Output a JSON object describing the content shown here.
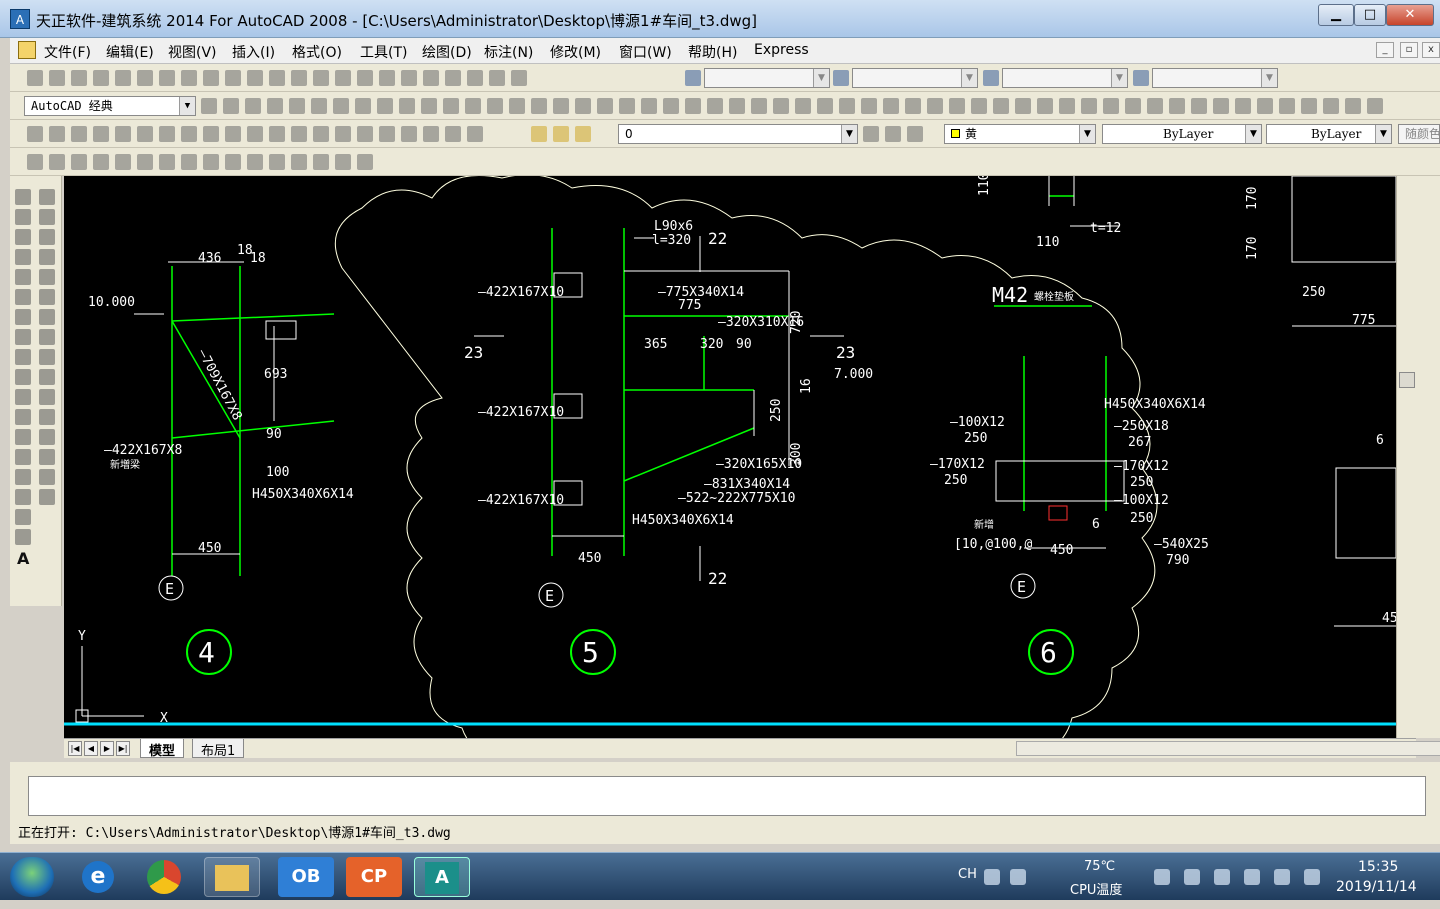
{
  "window": {
    "title": "天正软件-建筑系统 2014  For AutoCAD 2008 - [C:\\Users\\Administrator\\Desktop\\博源1#车间_t3.dwg]",
    "minimize": "▁",
    "maximize": "□",
    "close": "✕"
  },
  "menu": {
    "items": [
      "文件(F)",
      "编辑(E)",
      "视图(V)",
      "插入(I)",
      "格式(O)",
      "工具(T)",
      "绘图(D)",
      "标注(N)",
      "修改(M)",
      "窗口(W)",
      "帮助(H)",
      "Express"
    ]
  },
  "toolbar": {
    "workspace": "AutoCAD 经典",
    "layer": "0",
    "color": "黄",
    "linetype": "ByLayer",
    "lineweight": "ByLayer",
    "plotstyle": "随颜色"
  },
  "drawing": {
    "details": [
      {
        "label": "4",
        "axis": "E"
      },
      {
        "label": "5",
        "axis": "E"
      },
      {
        "label": "6",
        "axis": "E"
      }
    ],
    "texts": {
      "d436": "436",
      "d18a": "18",
      "d18b": "18",
      "elev10": "10.000",
      "d693": "693",
      "member_a": "—709X167X8",
      "d90": "90",
      "d100": "100",
      "member_b": "—422X167X8",
      "note_a": "新増梁",
      "member_c": "H450X340X6X14",
      "d450a": "450",
      "angle": "L90x6",
      "angle_len": "l=320",
      "n22a": "22",
      "n23a": "23",
      "n23b": "23",
      "n22b": "22",
      "pl1": "—422X167X10",
      "pl2": "—422X167X10",
      "pl3": "—422X167X10",
      "pl4": "—775X340X14",
      "d775": "775",
      "pl5": "—320X310X16",
      "d365": "365",
      "d320": "320",
      "d90b": "90",
      "d720": "720",
      "elev7": "7.000",
      "d16": "16",
      "d250": "250",
      "d300": "300",
      "pl6": "—320X165X10",
      "pl7": "—831X340X14",
      "pl8": "—522~222X775X10",
      "member_d": "H450X340X6X14",
      "d450b": "450",
      "d110a": "110",
      "d110b": "110",
      "t12": "t=12",
      "m42": "M42",
      "m42note": "螺栓垫板",
      "h_main": "H450X340X6X14",
      "p100x12": "—100X12",
      "p100x12v": "250",
      "p250x18": "—250X18",
      "p250x18v": "267",
      "p170x12a": "—170X12",
      "p170x12av": "250",
      "p170x12b": "—170X12",
      "p170x12bv": "250",
      "p100x12b": "—100X12",
      "p100x12bv": "250",
      "p540x25": "—540X25",
      "p540x25v": "790",
      "weld_a": "6",
      "note_b": "新增",
      "anchor": "[10,@100,@",
      "d450c": "450",
      "r170a": "170",
      "r170b": "170",
      "r250": "250",
      "r775": "775",
      "r6": "6",
      "r45": "45",
      "axis_y": "Y",
      "axis_x": "X"
    }
  },
  "tabs": {
    "model": "模型",
    "layout": "布局1"
  },
  "status": {
    "opening": "正在打开: C:\\Users\\Administrator\\Desktop\\博源1#车间_t3.dwg"
  },
  "taskbar": {
    "apps": [
      {
        "name": "ie",
        "label": "e",
        "color": "#1f74c9"
      },
      {
        "name": "chrome",
        "label": "",
        "color": "#d9462e"
      },
      {
        "name": "explorer",
        "label": "",
        "color": "#e9c25a"
      },
      {
        "name": "ob",
        "label": "OB",
        "color": "#2f7fd6"
      },
      {
        "name": "cp",
        "label": "CP",
        "color": "#e5622a"
      },
      {
        "name": "autocad",
        "label": "A",
        "color": "#1b8f8a"
      }
    ],
    "lang": "CH",
    "temp": "75℃",
    "temp_label": "CPU温度",
    "time": "15:35",
    "date": "2019/11/14"
  }
}
